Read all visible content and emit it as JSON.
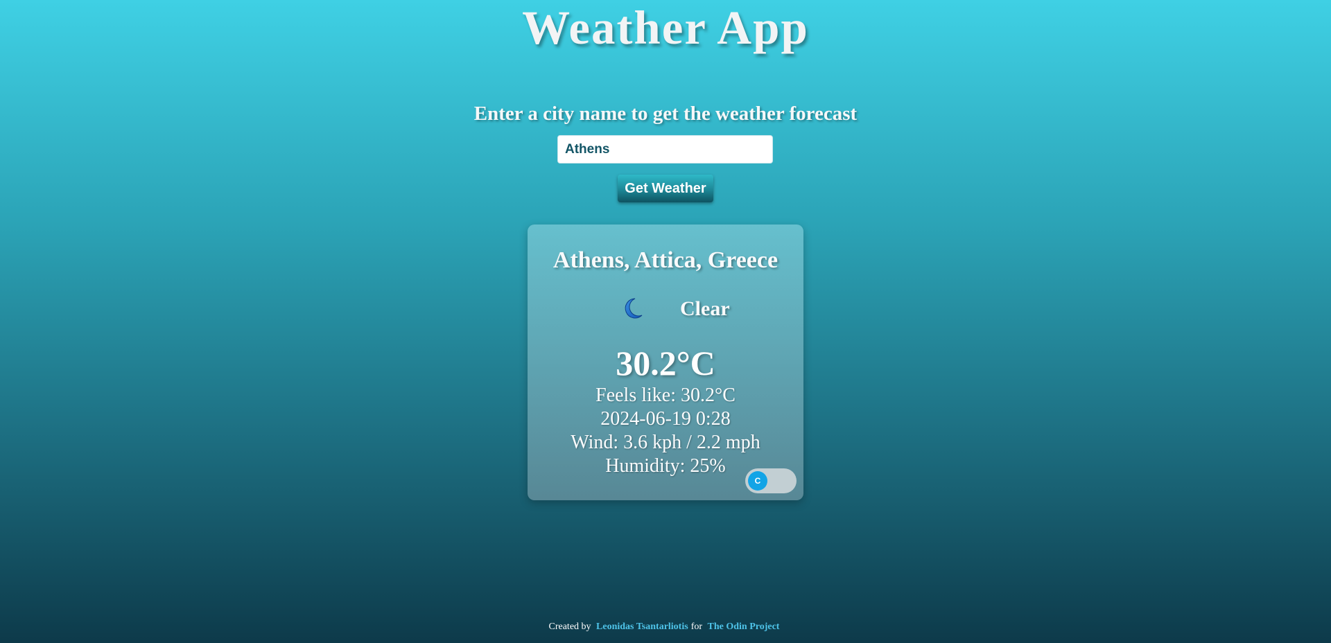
{
  "header": {
    "title": "Weather App"
  },
  "search": {
    "prompt": "Enter a city name to get the weather forecast",
    "input_value": "Athens",
    "button_label": "Get Weather"
  },
  "weather": {
    "location": "Athens, Attica, Greece",
    "condition_icon": "crescent-moon-icon",
    "condition": "Clear",
    "temperature": "30.2°C",
    "feels_like": "Feels like: 30.2°C",
    "datetime": "2024-06-19 0:28",
    "wind": "Wind: 3.6 kph / 2.2 mph",
    "humidity": "Humidity: 25%",
    "unit_toggle_label": "C"
  },
  "footer": {
    "created_by": "Created by",
    "author": "Leonidas Tsantarliotis",
    "for_text": "for",
    "project": "The Odin Project"
  },
  "colors": {
    "accent": "#12a4e6",
    "link": "#4ec3e8",
    "input_text": "#135566"
  }
}
